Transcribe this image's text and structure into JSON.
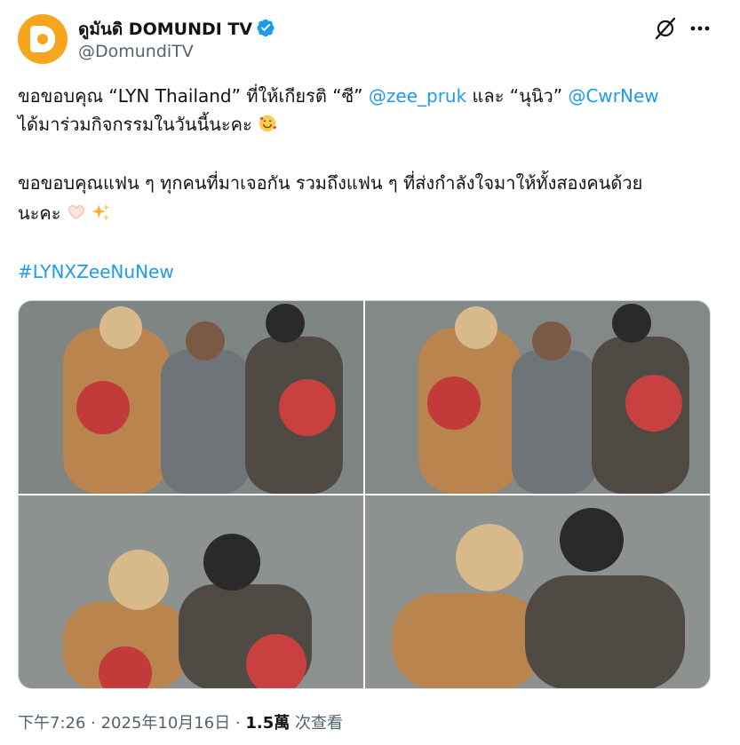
{
  "author": {
    "display_name": "ดูมันดิ DOMUNDI TV",
    "handle": "@DomundiTV"
  },
  "tweet": {
    "line1_a": "ขอขอบคุณ “LYN Thailand” ที่ให้เกียรติ “ซี” ",
    "mention1": "@zee_pruk",
    "line1_b": " และ “นุนิว” ",
    "mention2": "@CwrNew",
    "line2": "ได้มาร่วมกิจกรรมในวันนี้นะคะ",
    "line3": "ขอขอบคุณแฟน ๆ ทุกคนที่มาเจอกัน รวมถึงแฟน ๆ ที่ส่งกำลังใจมาให้ทั้งสองคนด้วย",
    "line4": "นะคะ",
    "hashtag": "#LYNXZeeNuNew"
  },
  "footer": {
    "time_date": "下午7:26 · 2025年10月16日 · ",
    "views_count": "1.5萬",
    "views_label": " 次查看"
  },
  "icons": {
    "verified": "verified-badge-icon",
    "grok": "grok-icon",
    "more": "more-icon",
    "emoji_love": "smiling-face-with-hearts-emoji",
    "emoji_heart_hands": "heart-hands-emoji",
    "emoji_sparkles": "sparkles-emoji"
  },
  "colors": {
    "accent": "#1d9bf0",
    "avatar": "#f6a51d",
    "muted": "#536471"
  }
}
